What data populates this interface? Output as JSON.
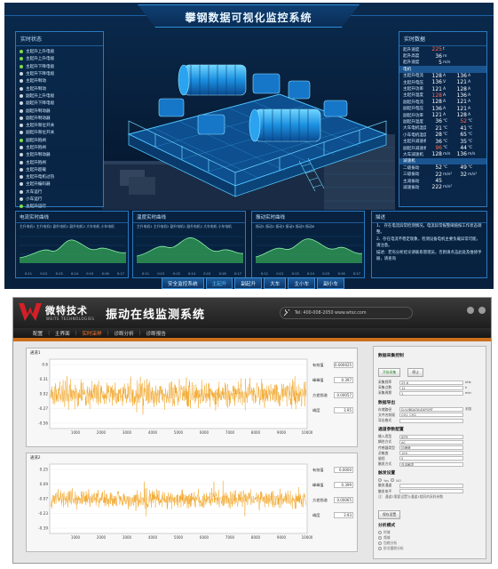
{
  "dashboard": {
    "title": "攀钢数据可视化监控系统",
    "left_panel": {
      "title": "实时状态",
      "items": [
        {
          "label": "主起升上升电极",
          "on": true
        },
        {
          "label": "主起升上升电极",
          "on": true
        },
        {
          "label": "主起升下降电极",
          "on": true
        },
        {
          "label": "主起升下降电极",
          "on": false
        },
        {
          "label": "主起升制动",
          "on": false
        },
        {
          "label": "主起升制动",
          "on": false
        },
        {
          "label": "副起升上升电极",
          "on": false
        },
        {
          "label": "副起升下降电极",
          "on": false
        },
        {
          "label": "副起升制动器",
          "on": false
        },
        {
          "label": "副起升制动器",
          "on": false
        },
        {
          "label": "主起升限位开关",
          "on": false
        },
        {
          "label": "副起升限位开关",
          "on": false
        },
        {
          "label": "副起升抱闸",
          "on": true
        },
        {
          "label": "主起升抱闸",
          "on": false
        },
        {
          "label": "主起升制动器",
          "on": false
        },
        {
          "label": "主起升抱闸",
          "on": false
        },
        {
          "label": "主起升超载",
          "on": false
        },
        {
          "label": "主起升电机过热",
          "on": false
        },
        {
          "label": "主起升编码器",
          "on": false
        },
        {
          "label": "大车运行",
          "on": false
        },
        {
          "label": "小车运行",
          "on": false
        },
        {
          "label": "主起升运行",
          "on": true
        }
      ]
    },
    "right_panel": {
      "title": "实时数据",
      "top_rows": [
        {
          "label": "起升速度",
          "v1": "225",
          "u1": "t",
          "red": true
        },
        {
          "label": "起升高度",
          "v1": "36",
          "u1": "m",
          "red": false
        },
        {
          "label": "起升速度",
          "v1": "5",
          "u1": "m/s",
          "red": false
        }
      ],
      "section1": "电机",
      "rows": [
        {
          "label": "主起升电流",
          "v1": "128",
          "u1": "A",
          "v2": "136",
          "u2": "A",
          "r1": false,
          "r2": false
        },
        {
          "label": "主起升电压",
          "v1": "136",
          "u1": "V",
          "v2": "121",
          "u2": "A",
          "r1": false,
          "r2": false
        },
        {
          "label": "主起升功率",
          "v1": "121",
          "u1": "A",
          "v2": "128",
          "u2": "A",
          "r1": false,
          "r2": false
        },
        {
          "label": "主起升温度",
          "v1": "128",
          "u1": "A",
          "v2": "136",
          "u2": "A",
          "r1": true,
          "r2": false
        },
        {
          "label": "副起升电流",
          "v1": "128",
          "u1": "A",
          "v2": "121",
          "u2": "A",
          "r1": false,
          "r2": false
        },
        {
          "label": "副起升电压",
          "v1": "136",
          "u1": "A",
          "v2": "121",
          "u2": "A",
          "r1": false,
          "r2": false
        },
        {
          "label": "副起升功率",
          "v1": "121",
          "u1": "A",
          "v2": "128",
          "u2": "A",
          "r1": false,
          "r2": false
        },
        {
          "label": "副起升温度",
          "v1": "36",
          "u1": "℃",
          "v2": "52",
          "u2": "℃",
          "r1": false,
          "r2": true
        },
        {
          "label": "大车电机温度",
          "v1": "21",
          "u1": "℃",
          "v2": "41",
          "u2": "℃",
          "r1": false,
          "r2": false
        },
        {
          "label": "小车电机温度",
          "v1": "28",
          "u1": "℃",
          "v2": "65",
          "u2": "℃",
          "r1": false,
          "r2": false
        },
        {
          "label": "主起升减速机",
          "v1": "36",
          "u1": "℃",
          "v2": "35",
          "u2": "℃",
          "r1": false,
          "r2": false
        },
        {
          "label": "副起升减速机",
          "v1": "96",
          "u1": "℃",
          "v2": "44",
          "u2": "℃",
          "r1": true,
          "r2": false
        },
        {
          "label": "大车减速机",
          "v1": "128",
          "u1": "m/s",
          "v2": "136",
          "u2": "m/s",
          "r1": false,
          "r2": false
        }
      ],
      "section2": "减速机",
      "rows2": [
        {
          "label": "二级振动",
          "v1": "52",
          "u1": "℃",
          "v2": "49",
          "u2": "℃"
        },
        {
          "label": "三级振动",
          "v1": "22",
          "u1": "m/s²",
          "v2": "32",
          "u2": "m/s²"
        },
        {
          "label": "主减振动",
          "v1": "45",
          "u1": "",
          "v2": "",
          "u2": ""
        },
        {
          "label": "减速振动",
          "v1": "222",
          "u1": "m/s²",
          "v2": "",
          "u2": ""
        }
      ]
    },
    "charts": [
      {
        "title": "电流实时曲线",
        "legend": "主升电机1  主升电机2  副升电机1  副升电机2  大车电机  小车电机",
        "ticks": [
          "0:11",
          "0:12",
          "0:13",
          "0:14",
          "0:15",
          "0:16",
          "0:17"
        ]
      },
      {
        "title": "温度实时曲线",
        "legend": "主升电机1  主升电机2  副升电机1  副升电机2  大车电机  小车电机",
        "ticks": [
          "0:11",
          "0:12",
          "0:13",
          "0:14",
          "0:15",
          "0:16",
          "0:17"
        ]
      },
      {
        "title": "振动实时曲线",
        "legend": "振动1  振动2  振动3  振动4  振动5  振动6",
        "ticks": [
          "0:11",
          "0:12",
          "0:13",
          "0:14",
          "0:15",
          "0:16",
          "0:17"
        ]
      }
    ],
    "notes": {
      "title": "描述",
      "lines": [
        "1、 存在电流异常检测情况，电流异常报警阈值按工作状态调整。",
        "2、存在电流不稳定现象，检测设备电机主要负载异常可能，请注意。",
        "描述：若有分析结论请联系管理员，否则请点击此处及维修手册，请查询"
      ]
    },
    "nav": [
      {
        "label": "安全监控系统",
        "active": false
      },
      {
        "label": "主起升",
        "active": true
      },
      {
        "label": "副起升",
        "active": false
      },
      {
        "label": "大车",
        "active": false
      },
      {
        "label": "主小车",
        "active": false
      },
      {
        "label": "副小车",
        "active": false
      }
    ]
  },
  "app": {
    "logo_cn": "微特技术",
    "logo_en": "WEITE TECHNOLOGIES",
    "title": "振动在线监测系统",
    "contact": "Tel: 400-008-2050   www.wtsz.com",
    "menu": [
      {
        "label": "配置",
        "active": false
      },
      {
        "label": "主界面",
        "active": false
      },
      {
        "label": "实时采样",
        "active": true
      },
      {
        "label": "诊断分析",
        "active": false
      },
      {
        "label": "诊断报告",
        "active": false
      }
    ],
    "chart1": {
      "label": "通道1",
      "yticks": [
        "0.6",
        "0.31",
        "0.02",
        "-0.27",
        "-0.56"
      ],
      "xticks": [
        "1000",
        "2000",
        "3000",
        "4000",
        "5000",
        "6000",
        "7000",
        "8000",
        "9000",
        "10000"
      ],
      "stats": [
        {
          "label": "有效值",
          "value": "0.000025"
        },
        {
          "label": "峰峰值",
          "value": "0.397"
        },
        {
          "label": "方差频谱",
          "value": "0.00057"
        },
        {
          "label": "峭度",
          "value": "3.95"
        }
      ]
    },
    "chart2": {
      "label": "通道2",
      "yticks": [
        "0.25",
        "0.09",
        "-0.07",
        "-0.23",
        "-0.39"
      ],
      "xticks": [
        "1000",
        "2000",
        "3000",
        "4000",
        "5000",
        "6000",
        "7000",
        "8000",
        "9000",
        "10000"
      ],
      "stats": [
        {
          "label": "有效值",
          "value": "0.0000"
        },
        {
          "label": "峰峰值",
          "value": "0.399"
        },
        {
          "label": "方差频谱",
          "value": "0.00065"
        },
        {
          "label": "峭度",
          "value": "3.93"
        }
      ]
    },
    "settings": {
      "title1": "数据采集控制",
      "btn_start": "开始采集",
      "btn_stop": "停止",
      "fields1": [
        {
          "label": "采集频率",
          "value": "25.6",
          "unit": "kHz"
        },
        {
          "label": "采集点数",
          "value": "12",
          "unit": "k"
        },
        {
          "label": "采集周期",
          "value": "1",
          "unit": "min"
        }
      ],
      "title2": "数据导出",
      "fields2": [
        {
          "label": "存储路径",
          "value": "D:\\VIBDATA\\EXPORT",
          "unit": "浏览"
        },
        {
          "label": "文件名前缀",
          "value": "CH1_CH2",
          "unit": ""
        },
        {
          "label": "导出格式",
          "value": "",
          "unit": ""
        }
      ],
      "title3": "通道参数配置",
      "fields3": [
        {
          "label": "输入类型",
          "value": "IEPE",
          "unit": ""
        },
        {
          "label": "耦合方式",
          "value": "AC",
          "unit": ""
        },
        {
          "label": "传感器类型",
          "value": "加速度",
          "unit": ""
        },
        {
          "label": "灵敏度",
          "value": "100",
          "unit": ""
        },
        {
          "label": "量程",
          "value": "5",
          "unit": ""
        },
        {
          "label": "触发方式",
          "value": "自由触发",
          "unit": ""
        }
      ],
      "title4": "触发设置",
      "trigger_opts": [
        "Yes",
        "NO"
      ],
      "fields4": [
        {
          "label": "触发通道",
          "value": "",
          "unit": ""
        },
        {
          "label": "触发电平",
          "value": "",
          "unit": ""
        }
      ],
      "note": "注：通道2需要设置与通道1相同的采样参数",
      "btn_save": "保存设置",
      "title5": "分析模式",
      "modes": [
        "时域",
        "频域",
        "包络分析",
        "阶次跟踪分析"
      ]
    }
  },
  "colors": {
    "dash_bg": "#061a33",
    "dash_accent": "#2b79bf",
    "wave_orange": "#f0a11e",
    "app_accent": "#ff7a2a"
  }
}
